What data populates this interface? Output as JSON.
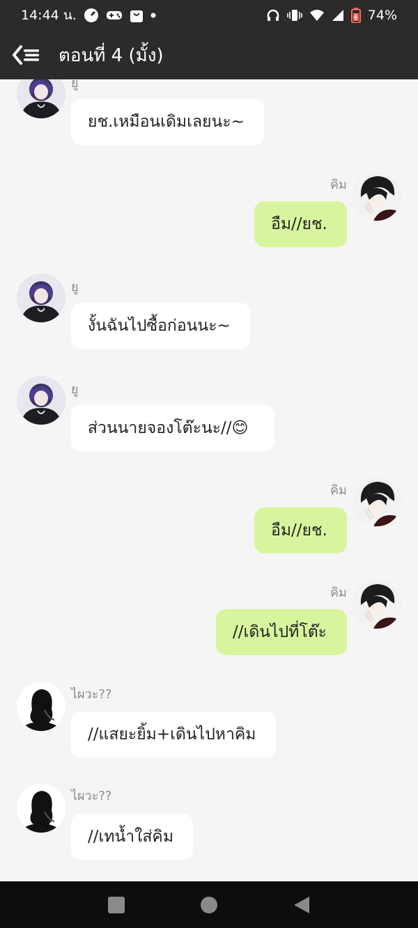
{
  "status": {
    "time": "14:44 น.",
    "battery": "74%",
    "icons_left": [
      "speedometer-icon",
      "gamepad-icon",
      "shopping-bag-icon",
      "dot-icon"
    ],
    "icons_right": [
      "headphones-icon",
      "vibrate-icon",
      "wifi-icon",
      "signal-icon",
      "battery-icon"
    ]
  },
  "appbar": {
    "title": "ตอนที่ 4 (มั้ง)",
    "back_icon": "back-list-icon"
  },
  "messages": [
    {
      "side": "left",
      "sender": "ยู",
      "text": "ยช.เหมือนเดิมเลยนะ~",
      "avatar": "yu"
    },
    {
      "side": "right",
      "sender": "คิม",
      "text": "อืม//ยช.",
      "avatar": "kim"
    },
    {
      "side": "left",
      "sender": "ยู",
      "text": "งั้นฉันไปซื้อก่อนนะ~",
      "avatar": "yu"
    },
    {
      "side": "left",
      "sender": "ยู",
      "text": "ส่วนนายจองโต๊ะนะ//😊",
      "avatar": "yu"
    },
    {
      "side": "right",
      "sender": "คิม",
      "text": "อืม//ยช.",
      "avatar": "kim"
    },
    {
      "side": "right",
      "sender": "คิม",
      "text": "//เดินไปที่โต๊ะ",
      "avatar": "kim"
    },
    {
      "side": "left",
      "sender": "ไผวะ??",
      "text": "//แสยะยิ้ม+เดินไปหาคิม",
      "avatar": "silhouette"
    },
    {
      "side": "left",
      "sender": "ไผวะ??",
      "text": "//เทน้ำใส่คิม",
      "avatar": "silhouette"
    }
  ],
  "colors": {
    "bar": "#2b2b2b",
    "chat_bg": "#f5f5f5",
    "left_bubble": "#ffffff",
    "right_bubble": "#d8f59e",
    "nav_bg": "#0d0d0d"
  },
  "navbar": [
    "recents-square-icon",
    "home-circle-icon",
    "back-triangle-icon"
  ]
}
